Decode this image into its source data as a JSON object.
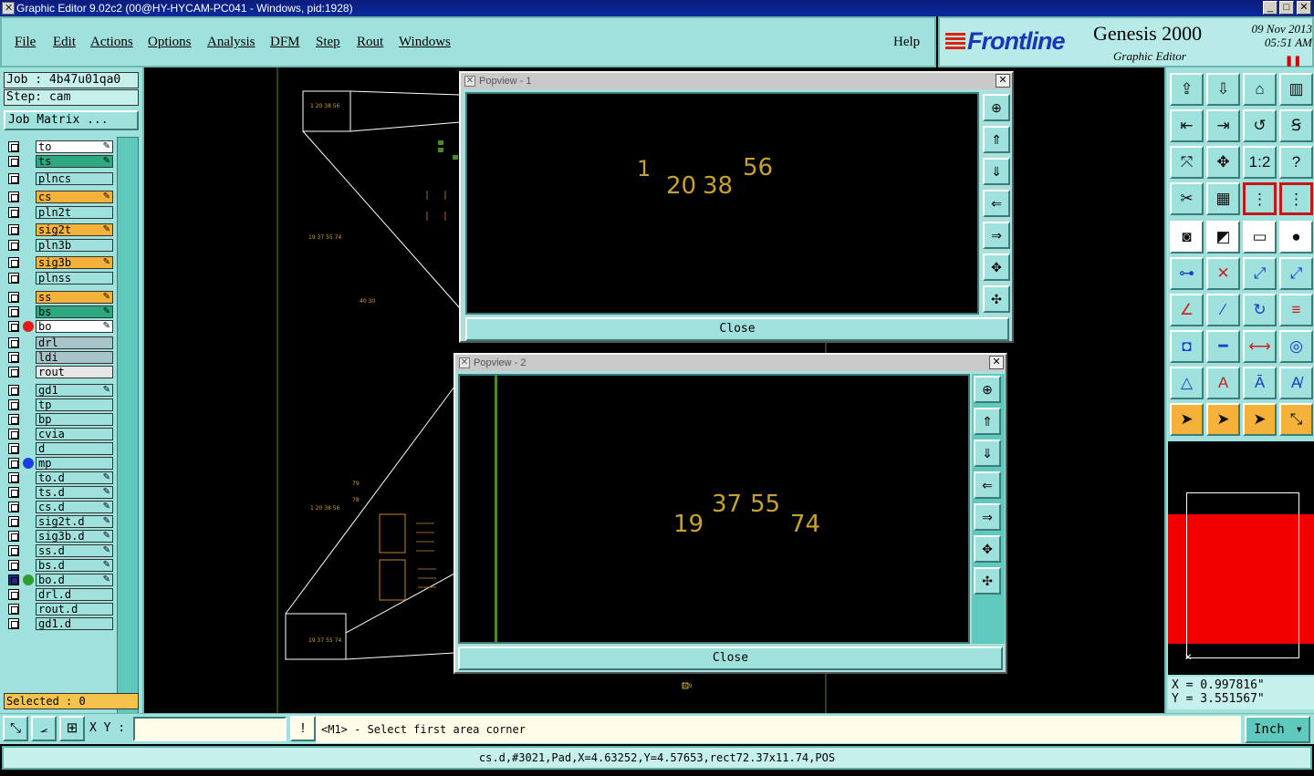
{
  "window": {
    "title": "Graphic Editor 9.02c2 (00@HY-HYCAM-PC041 - Windows, pid:1928)"
  },
  "menu": [
    "File",
    "Edit",
    "Actions",
    "Options",
    "Analysis",
    "DFM",
    "Step",
    "Rout",
    "Windows"
  ],
  "menu_help": "Help",
  "brand": {
    "logo": "Frontline",
    "product": "Genesis 2000",
    "subtitle": "Graphic Editor",
    "date": "09 Nov 2013",
    "time": "05:51 AM"
  },
  "job": {
    "job_label": "Job : 4b47u01qa0",
    "step_label": "Step: cam",
    "matrix_button": "Job Matrix ..."
  },
  "layers": [
    {
      "name": "to",
      "color": "#ffffff",
      "pen": true
    },
    {
      "name": "ts",
      "color": "#2ea87e",
      "pen": true
    },
    {
      "name": "plncs",
      "color": "#9fe1dc",
      "pen": false
    },
    {
      "name": "cs",
      "color": "#f5b23a",
      "pen": true
    },
    {
      "name": "pln2t",
      "color": "#9fe1dc",
      "pen": false
    },
    {
      "name": "sig2t",
      "color": "#f5b23a",
      "pen": true
    },
    {
      "name": "pln3b",
      "color": "#9fe1dc",
      "pen": false
    },
    {
      "name": "sig3b",
      "color": "#f5b23a",
      "pen": true
    },
    {
      "name": "plnss",
      "color": "#9fe1dc",
      "pen": false
    },
    {
      "name": "ss",
      "color": "#f5b23a",
      "pen": true
    },
    {
      "name": "bs",
      "color": "#2ea87e",
      "pen": true
    },
    {
      "name": "bo",
      "color": "#ffffff",
      "pen": true,
      "dot": "#e01c1c"
    },
    {
      "name": "drl",
      "color": "#a7c4c8",
      "pen": false
    },
    {
      "name": "ldi",
      "color": "#a7c4c8",
      "pen": false
    },
    {
      "name": "rout",
      "color": "#e6e6e6",
      "pen": false
    },
    {
      "name": "gd1",
      "color": "#9fe1dc",
      "pen": true
    },
    {
      "name": "tp",
      "color": "#9fe1dc",
      "pen": false
    },
    {
      "name": "bp",
      "color": "#9fe1dc",
      "pen": false
    },
    {
      "name": "cvia",
      "color": "#9fe1dc",
      "pen": false
    },
    {
      "name": "d",
      "color": "#9fe1dc",
      "pen": false
    },
    {
      "name": "mp",
      "color": "#9fe1dc",
      "pen": false,
      "dot": "#1b3fe0"
    },
    {
      "name": "to.d",
      "color": "#9fe1dc",
      "pen": true
    },
    {
      "name": "ts.d",
      "color": "#9fe1dc",
      "pen": true
    },
    {
      "name": "cs.d",
      "color": "#9fe1dc",
      "pen": true
    },
    {
      "name": "sig2t.d",
      "color": "#9fe1dc",
      "pen": true
    },
    {
      "name": "sig3b.d",
      "color": "#9fe1dc",
      "pen": true
    },
    {
      "name": "ss.d",
      "color": "#9fe1dc",
      "pen": true
    },
    {
      "name": "bs.d",
      "color": "#9fe1dc",
      "pen": true
    },
    {
      "name": "bo.d",
      "color": "#9fe1dc",
      "pen": true,
      "dot": "#2e9e2e",
      "selected": true
    },
    {
      "name": "drl.d",
      "color": "#9fe1dc",
      "pen": false
    },
    {
      "name": "rout.d",
      "color": "#9fe1dc",
      "pen": false
    },
    {
      "name": "gd1.d",
      "color": "#9fe1dc",
      "pen": false
    }
  ],
  "selected_label": "Selected : 0",
  "popview1": {
    "title": "Popview - 1",
    "numbers": [
      "1",
      "20",
      "38",
      "56"
    ],
    "close_label": "Close"
  },
  "popview2": {
    "title": "Popview - 2",
    "numbers": [
      "19",
      "37",
      "55",
      "74"
    ],
    "close_label": "Close"
  },
  "coords": {
    "x": "X = 0.997816\"",
    "y": "Y = 3.551567\""
  },
  "command": {
    "xy_label": "X Y :",
    "xy_value": "",
    "prompt": "<M1> - Select first area corner",
    "unit": "Inch"
  },
  "status_line": "cs.d,#3021,Pad,X=4.63252,Y=4.57653,rect72.37x11.74,POS",
  "canvas_labels": {
    "top_pad": "1 20 38 56",
    "mid_pad": "19 37 55 74",
    "mid2": "40 30",
    "bottom_pad_top": "1 20 38 56",
    "bottom_pad": "19 37 55 74",
    "small_a": "79",
    "small_b": "78",
    "bottom_mark": "609"
  },
  "toolbar_icons": [
    "open-icon",
    "save-icon",
    "home-icon",
    "window-icon",
    "zoom-left-icon",
    "zoom-right-icon",
    "undo-icon",
    "s-curve-icon",
    "fit-icon",
    "center-icon",
    "ratio-icon",
    "help-icon",
    "tools-icon",
    "grid-icon",
    "route-icon",
    "route-alt-icon",
    "pad-icon",
    "line-color-icon",
    "ruler-icon",
    "circle-icon",
    "node-icon",
    "cross-icon",
    "dot-line-icon",
    "dot-line-alt-icon",
    "angle-icon",
    "slash-icon",
    "arc-icon",
    "flip-icon",
    "pad-red-icon",
    "minus-icon",
    "measure-icon",
    "blob-icon",
    "triangle-icon",
    "a-icon",
    "a-bar-icon",
    "a-cross-icon",
    "pointer-icon",
    "pointer-box-icon",
    "pointer-orange-icon",
    "pointer-net-icon"
  ]
}
